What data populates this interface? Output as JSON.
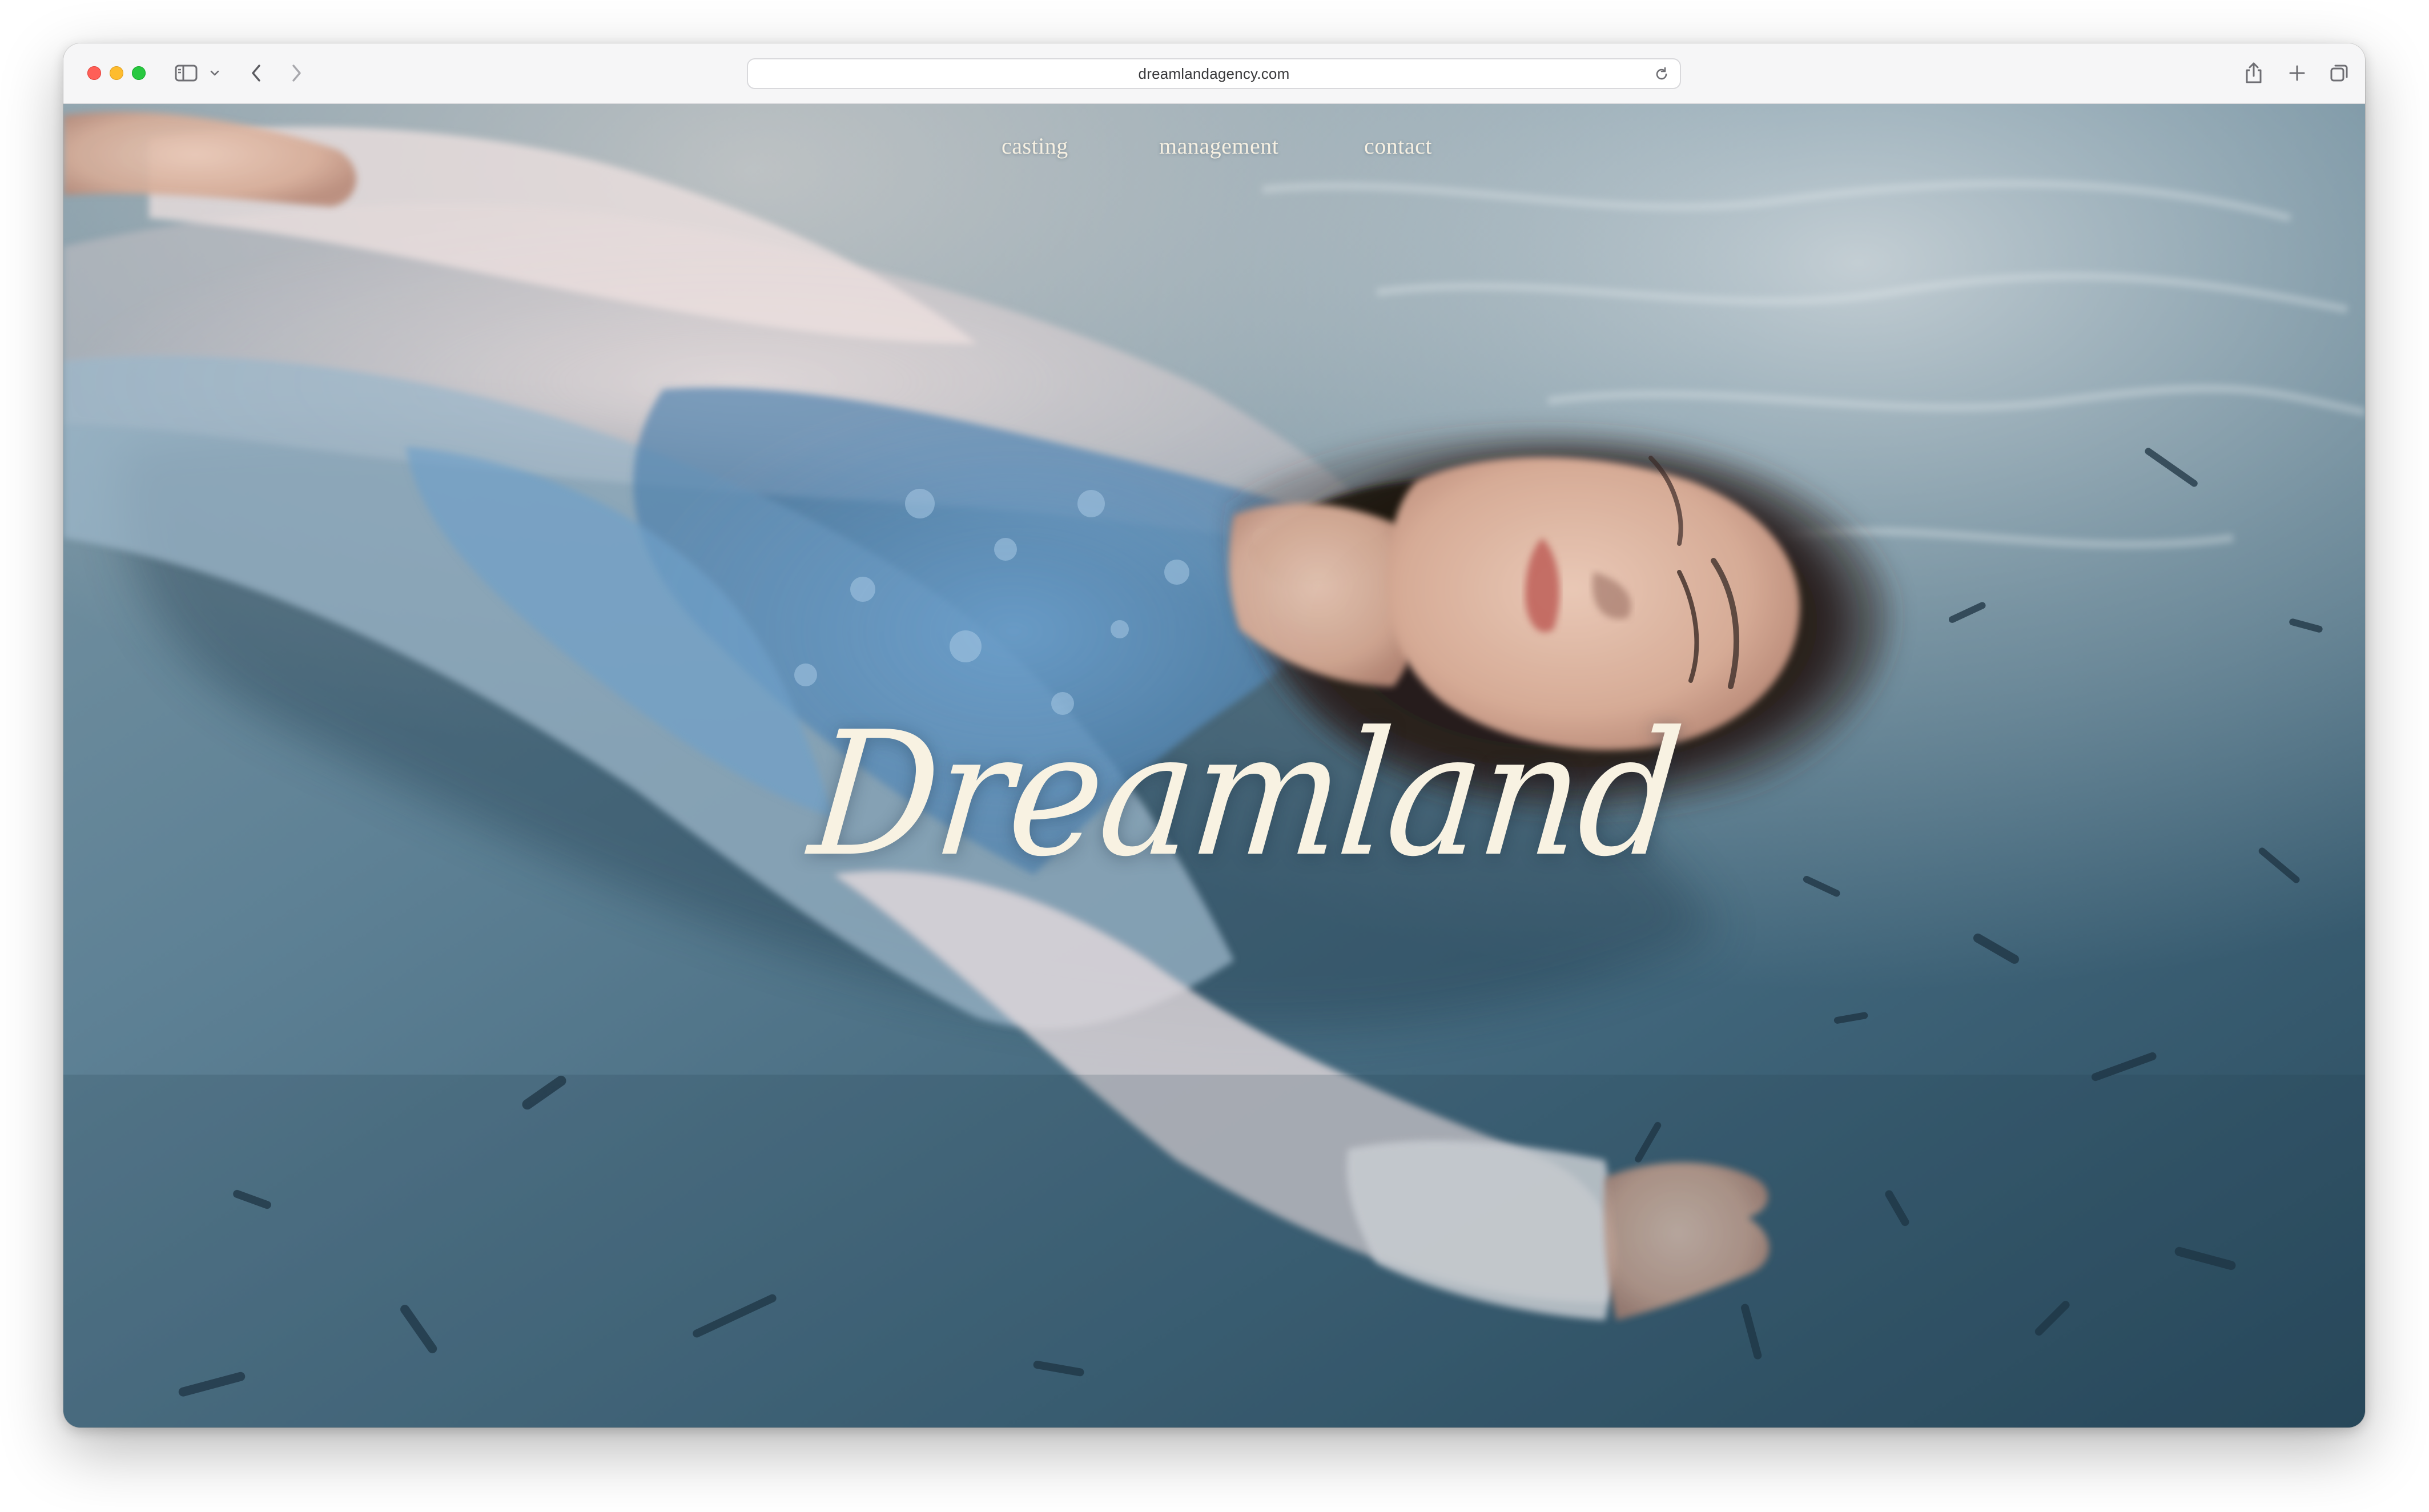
{
  "browser": {
    "url": "dreamlandagency.com",
    "icons": {
      "sidebar": "sidebar-icon",
      "sidebar_menu": "chevron-down-icon",
      "back": "chevron-left-icon",
      "forward": "chevron-right-icon",
      "reload": "reload-icon",
      "share": "share-icon",
      "new_tab": "plus-icon",
      "tab_overview": "tabs-icon"
    }
  },
  "site": {
    "nav": {
      "casting": "casting",
      "management": "management",
      "contact": "contact"
    },
    "logo": "Dreamland"
  },
  "colors": {
    "nav_text": "#f6f0e2",
    "logo_text": "#f8f2e2",
    "water_dark": "#2f5368",
    "water_light": "#a9bcc4"
  }
}
